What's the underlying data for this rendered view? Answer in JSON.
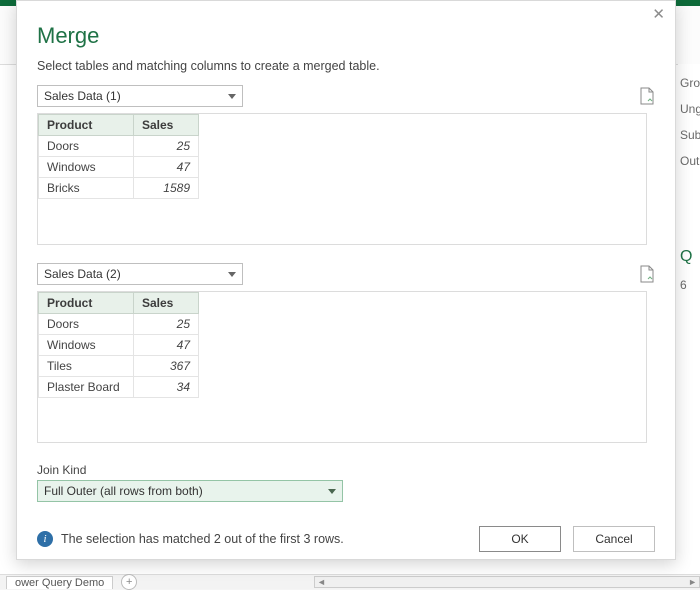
{
  "dialog": {
    "title": "Merge",
    "subtitle": "Select tables and matching columns to create a merged table.",
    "close_glyph": "✕"
  },
  "source1": {
    "selected": "Sales Data (1)",
    "columns": [
      "Product",
      "Sales"
    ],
    "rows": [
      {
        "product": "Doors",
        "sales": 25
      },
      {
        "product": "Windows",
        "sales": 47
      },
      {
        "product": "Bricks",
        "sales": 1589
      }
    ]
  },
  "source2": {
    "selected": "Sales Data (2)",
    "columns": [
      "Product",
      "Sales"
    ],
    "rows": [
      {
        "product": "Doors",
        "sales": 25
      },
      {
        "product": "Windows",
        "sales": 47
      },
      {
        "product": "Tiles",
        "sales": 367
      },
      {
        "product": "Plaster Board",
        "sales": 34
      }
    ]
  },
  "join_kind": {
    "label": "Join Kind",
    "selected": "Full Outer (all rows from both)"
  },
  "match_info": "The selection has matched 2 out of the first 3 rows.",
  "buttons": {
    "ok": "OK",
    "cancel": "Cancel"
  },
  "behind": {
    "right_items": [
      "Grou",
      "Ungr",
      "Subt",
      "Outl",
      "Q",
      "6"
    ],
    "sheet_tab": "ower Query Demo",
    "new_tab_glyph": "+",
    "scroll_left": "◄",
    "scroll_right": "►"
  }
}
